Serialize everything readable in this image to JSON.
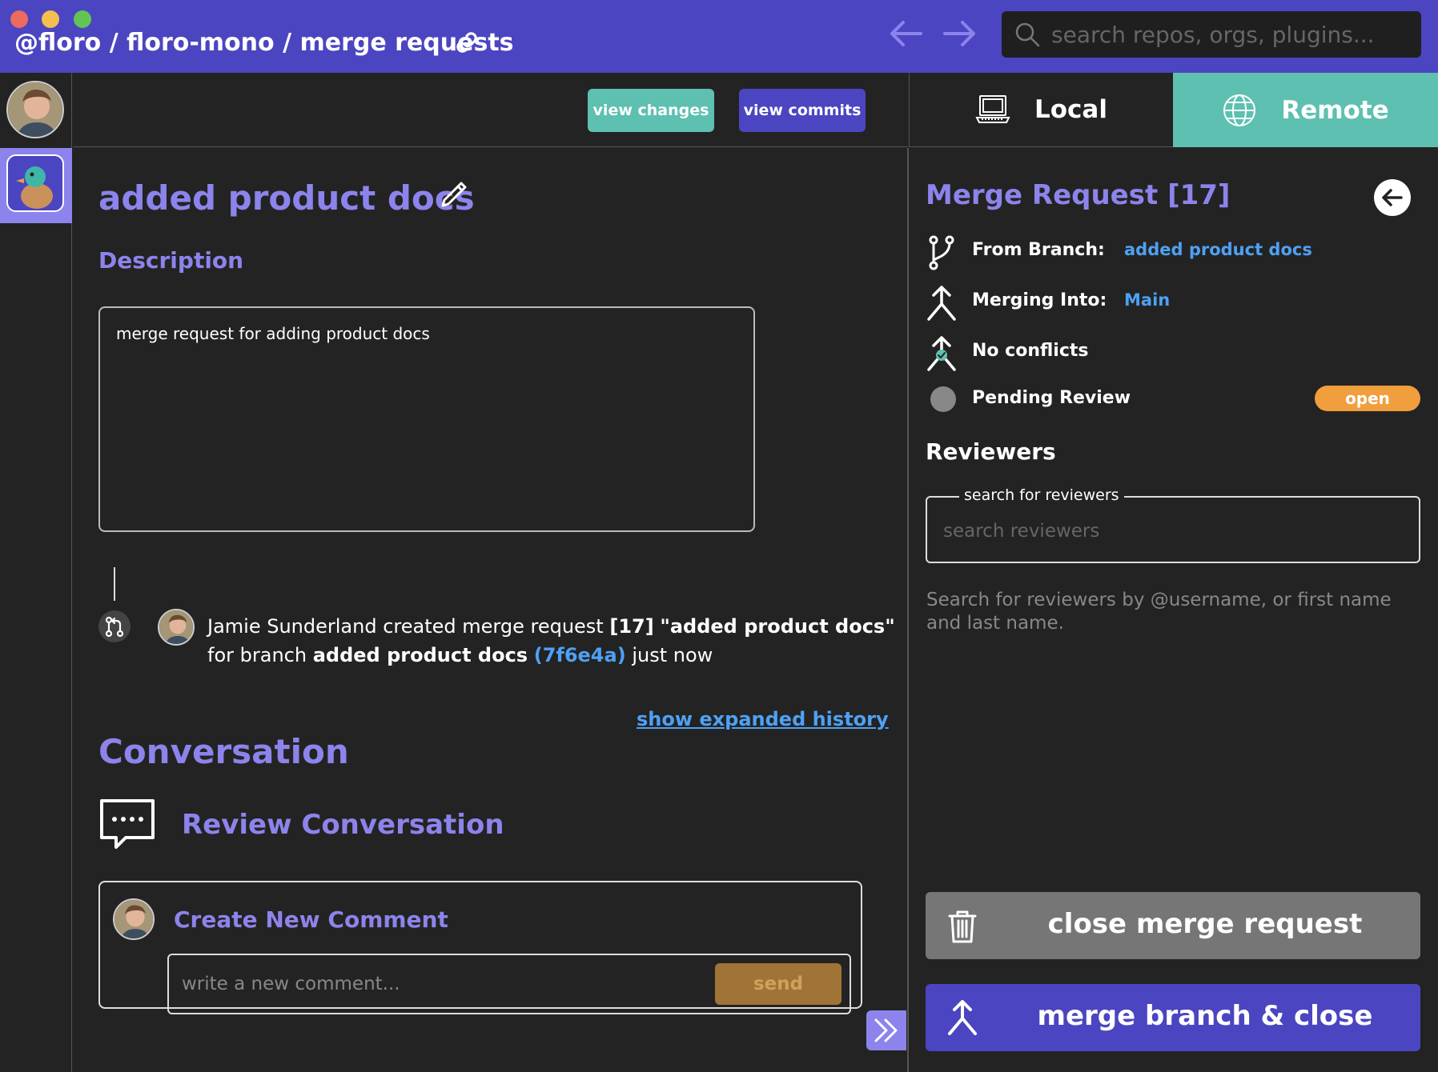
{
  "window": {
    "breadcrumb": "@floro / floro-mono / merge requests",
    "search_placeholder": "search repos, orgs, plugins..."
  },
  "toolbar": {
    "view_changes": "view changes",
    "view_commits": "view commits"
  },
  "tabs": {
    "local": "Local",
    "remote": "Remote"
  },
  "main": {
    "title": "added product docs",
    "description_label": "Description",
    "description_text": "merge request for adding product docs",
    "history": {
      "author": "Jamie Sunderland",
      "action": "created merge request",
      "mr_id": "[17]",
      "mr_title": "\"added product docs\"",
      "for_branch": "for branch",
      "branch": "added product docs",
      "sha": "(7f6e4a)",
      "when": "just now"
    },
    "expanded_history_link": "show expanded history",
    "conversation_title": "Conversation",
    "review_conversation": "Review Conversation",
    "create_comment_title": "Create New Comment",
    "comment_placeholder": "write a new comment...",
    "send": "send"
  },
  "panel": {
    "title": "Merge Request [17]",
    "from_branch_label": "From Branch:",
    "from_branch_value": "added product docs",
    "merging_into_label": "Merging Into:",
    "merging_into_value": "Main",
    "conflicts": "No conflicts",
    "pending_review": "Pending Review",
    "status_badge": "open",
    "reviewers_label": "Reviewers",
    "reviewers_legend": "search for reviewers",
    "reviewers_placeholder": "search reviewers",
    "reviewers_help": "Search for reviewers by @username, or first name and last name.",
    "close_button": "close merge request",
    "merge_button": "merge branch & close"
  },
  "colors": {
    "brand_purple": "#4c45c1",
    "accent_lavender": "#8c84ec",
    "teal": "#5ec0b1",
    "link_blue": "#4ea1f3",
    "badge_orange": "#f19e3d"
  }
}
